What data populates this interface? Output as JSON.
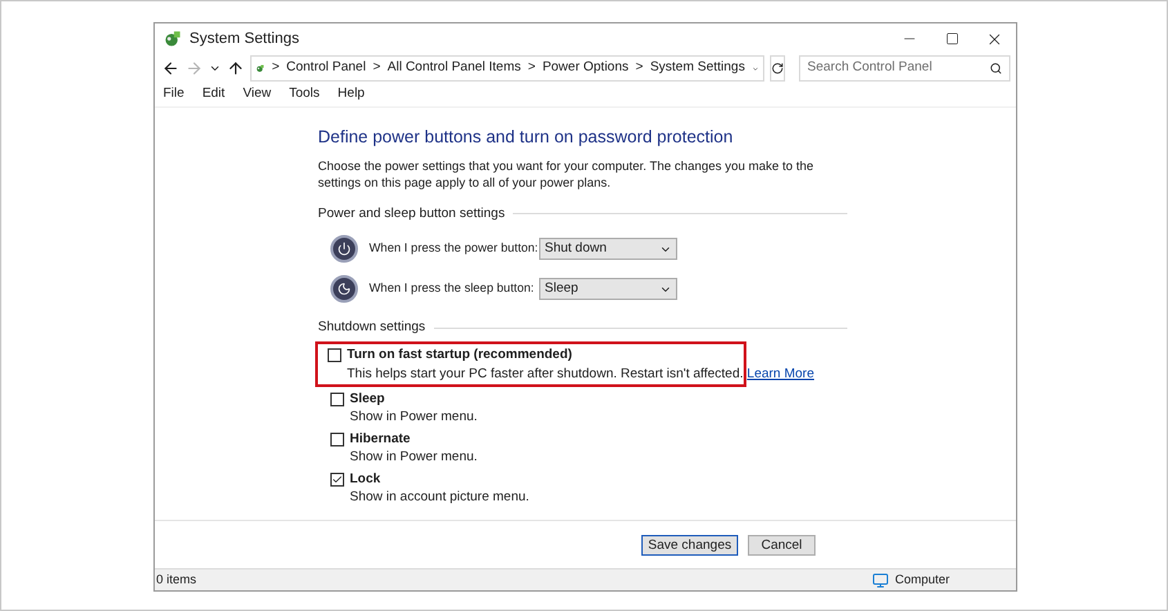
{
  "window": {
    "title": "System Settings"
  },
  "address_bar": {
    "crumbs": [
      "Control Panel",
      "All Control Panel Items",
      "Power Options",
      "System Settings"
    ],
    "separator": ">"
  },
  "search": {
    "placeholder": "Search Control Panel"
  },
  "menu": [
    "File",
    "Edit",
    "View",
    "Tools",
    "Help"
  ],
  "heading": "Define power buttons and turn on password protection",
  "intro": "Choose the power settings that you want for your computer. The changes you make to the settings on this page apply to all of your power plans.",
  "power_section": {
    "title": "Power and sleep button settings",
    "rows": [
      {
        "kind": "power",
        "label": "When I press the power button:",
        "value": "Shut down"
      },
      {
        "kind": "sleep",
        "label": "When I press the sleep button:",
        "value": "Sleep"
      }
    ]
  },
  "shutdown_section": {
    "title": "Shutdown settings",
    "options": [
      {
        "label": "Turn on fast startup (recommended)",
        "description": "This helps start your PC faster after shutdown. Restart isn't affected.",
        "link": "Learn More",
        "checked": false,
        "highlighted": true
      },
      {
        "label": "Sleep",
        "description": "Show in Power menu.",
        "checked": false,
        "highlighted": false
      },
      {
        "label": "Hibernate",
        "description": "Show in Power menu.",
        "checked": false,
        "highlighted": false
      },
      {
        "label": "Lock",
        "description": "Show in account picture menu.",
        "checked": true,
        "highlighted": false
      }
    ]
  },
  "buttons": [
    {
      "label": "Save changes",
      "default": true
    },
    {
      "label": "Cancel",
      "default": false
    }
  ],
  "status_bar": {
    "items": "0 items",
    "location": "Computer"
  }
}
